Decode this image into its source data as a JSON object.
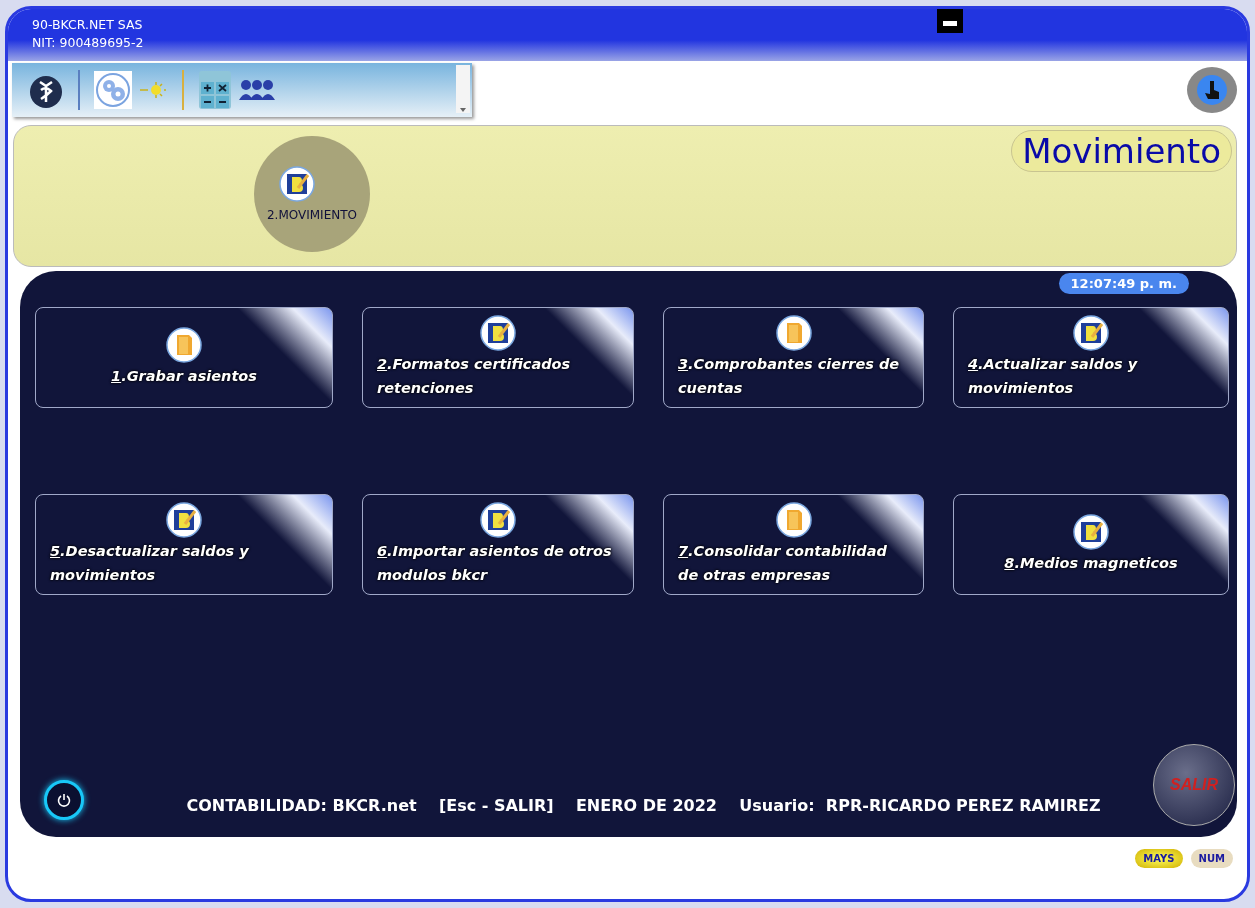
{
  "window": {
    "company": "90-BKCR.NET SAS",
    "nit": "NIT: 900489695-2"
  },
  "module": {
    "label": "2.MOVIMIENTO",
    "title": "Movimiento"
  },
  "clock": "12:07:49 p. m.",
  "tiles": [
    {
      "key": "1",
      "label": ".Grabar asientos",
      "kind": "folder"
    },
    {
      "key": "2",
      "label": ".Formatos certificados retenciones",
      "kind": "edit"
    },
    {
      "key": "3",
      "label": ".Comprobantes cierres de cuentas",
      "kind": "folder"
    },
    {
      "key": "4",
      "label": ".Actualizar saldos y movimientos",
      "kind": "edit"
    },
    {
      "key": "5",
      "label": ".Desactualizar saldos y movimientos",
      "kind": "edit"
    },
    {
      "key": "6",
      "label": ".Importar asientos de otros modulos bkcr",
      "kind": "edit"
    },
    {
      "key": "7",
      "label": ".Consolidar contabilidad de otras empresas",
      "kind": "folder"
    },
    {
      "key": "8",
      "label": ".Medios magneticos",
      "kind": "edit"
    }
  ],
  "footer": "CONTABILIDAD: BKCR.net    [Esc - SALIR]    ENERO DE 2022    Usuario:  RPR-RICARDO PEREZ RAMIREZ",
  "exit_button": "SALIR",
  "status_bar": [
    {
      "label": "MAYS",
      "on": true
    },
    {
      "label": "NUM",
      "on": false
    }
  ]
}
